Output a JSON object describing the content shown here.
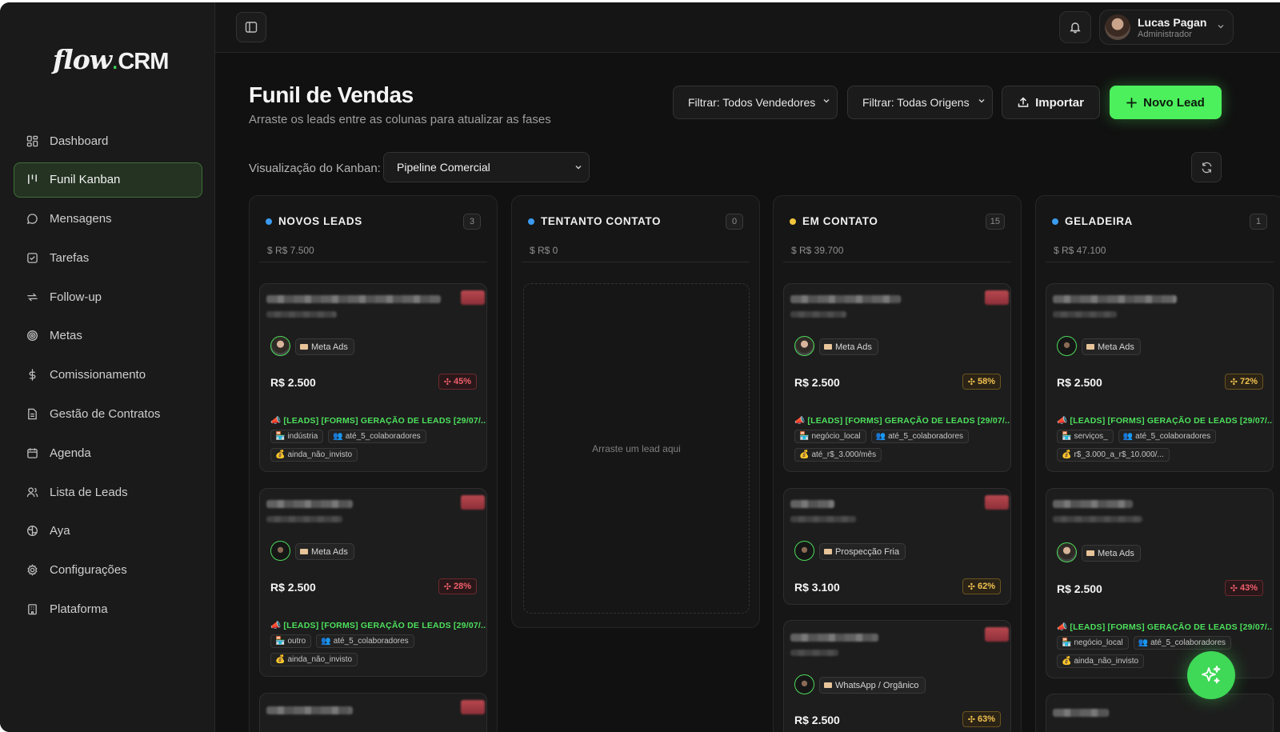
{
  "brand": {
    "logo_flow": "flow",
    "logo_dot": ".",
    "logo_crm": "CRM"
  },
  "sidebar": {
    "items": [
      {
        "label": "Dashboard",
        "icon": "dashboard-icon"
      },
      {
        "label": "Funil Kanban",
        "icon": "kanban-icon",
        "active": true
      },
      {
        "label": "Mensagens",
        "icon": "message-icon"
      },
      {
        "label": "Tarefas",
        "icon": "checkbox-icon"
      },
      {
        "label": "Follow-up",
        "icon": "repeat-icon"
      },
      {
        "label": "Metas",
        "icon": "target-icon"
      },
      {
        "label": "Comissionamento",
        "icon": "dollar-icon"
      },
      {
        "label": "Gestão de Contratos",
        "icon": "document-icon"
      },
      {
        "label": "Agenda",
        "icon": "calendar-icon"
      },
      {
        "label": "Lista de Leads",
        "icon": "users-icon"
      },
      {
        "label": "Aya",
        "icon": "brain-icon"
      },
      {
        "label": "Configurações",
        "icon": "gear-icon"
      },
      {
        "label": "Plataforma",
        "icon": "building-icon"
      }
    ]
  },
  "header": {
    "user": {
      "name": "Lucas Pagan",
      "role": "Administrador"
    }
  },
  "main": {
    "title": "Funil de Vendas",
    "subtitle": "Arraste os leads entre as colunas para atualizar as fases",
    "filter_sellers": "Filtrar: Todos Vendedores",
    "filter_origins": "Filtrar: Todas Origens",
    "import_label": "Importar",
    "new_lead_label": "Novo Lead",
    "kanban_view_label": "Visualização do Kanban:",
    "pipeline_selected": "Pipeline Comercial"
  },
  "columns": [
    {
      "title": "NOVOS LEADS",
      "count": "3",
      "total": "$ R$ 7.500",
      "dot_color": "#3b9bf0",
      "cards": [
        {
          "source": "Meta Ads",
          "value": "R$ 2.500",
          "prob": "45%",
          "prob_color": "red",
          "campaign": "[LEADS] [FORMS] GERAÇÃO DE LEADS [29/07/...",
          "chips": [
            "indústria",
            "até_5_colaboradores",
            "ainda_não_invisto"
          ]
        },
        {
          "source": "Meta Ads",
          "value": "R$ 2.500",
          "prob": "28%",
          "prob_color": "red",
          "campaign": "[LEADS] [FORMS] GERAÇÃO DE LEADS [29/07/...",
          "chips": [
            "outro",
            "até_5_colaboradores",
            "ainda_não_invisto"
          ]
        }
      ]
    },
    {
      "title": "TENTANTO CONTATO",
      "count": "0",
      "total": "$ R$ 0",
      "dot_color": "#3b9bf0",
      "empty_text": "Arraste um lead aqui"
    },
    {
      "title": "EM CONTATO",
      "count": "15",
      "total": "$ R$ 39.700",
      "dot_color": "#f2c53d",
      "cards": [
        {
          "source": "Meta Ads",
          "value": "R$ 2.500",
          "prob": "58%",
          "prob_color": "yellow",
          "campaign": "[LEADS] [FORMS] GERAÇÃO DE LEADS [29/07/...",
          "chips": [
            "negócio_local",
            "até_5_colaboradores",
            "até_r$_3.000/mês"
          ]
        },
        {
          "source": "Prospecção Fria",
          "value": "R$ 3.100",
          "prob": "62%",
          "prob_color": "yellow"
        },
        {
          "source": "WhatsApp / Orgânico",
          "value": "R$ 2.500",
          "prob": "63%",
          "prob_color": "yellow"
        }
      ]
    },
    {
      "title": "GELADEIRA",
      "count": "1",
      "total": "$ R$ 47.100",
      "dot_color": "#3b9bf0",
      "cards": [
        {
          "source": "Meta Ads",
          "value": "R$ 2.500",
          "prob": "72%",
          "prob_color": "yellow",
          "campaign": "[LEADS] [FORMS] GERAÇÃO DE LEADS [29/07/...",
          "chips": [
            "serviços_",
            "até_5_colaboradores",
            "r$_3.000_a_r$_10.000/..."
          ]
        },
        {
          "source": "Meta Ads",
          "value": "R$ 2.500",
          "prob": "43%",
          "prob_color": "red",
          "campaign": "[LEADS] [FORMS] GERAÇÃO DE LEADS [29/07/...",
          "chips": [
            "negócio_local",
            "até_5_colaboradores",
            "ainda_não_invisto"
          ]
        }
      ]
    }
  ],
  "colors": {
    "accent": "#4cf05c",
    "background": "#111111",
    "sidebar": "#1a1a1a"
  }
}
